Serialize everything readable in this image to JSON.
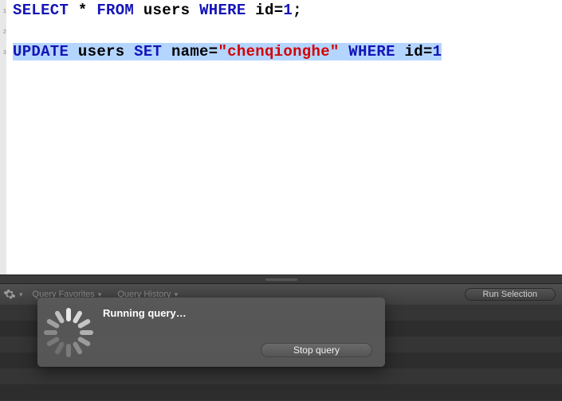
{
  "editor": {
    "line_numbers": [
      "1",
      "2",
      "3"
    ],
    "lines": [
      {
        "selected": false,
        "tokens": [
          {
            "t": "SELECT",
            "c": "kw"
          },
          {
            "t": " ",
            "c": "op"
          },
          {
            "t": "*",
            "c": "op"
          },
          {
            "t": " ",
            "c": "op"
          },
          {
            "t": "FROM",
            "c": "kw"
          },
          {
            "t": " ",
            "c": "op"
          },
          {
            "t": "users",
            "c": "id"
          },
          {
            "t": " ",
            "c": "op"
          },
          {
            "t": "WHERE",
            "c": "kw"
          },
          {
            "t": " ",
            "c": "op"
          },
          {
            "t": "id",
            "c": "id"
          },
          {
            "t": "=",
            "c": "op"
          },
          {
            "t": "1",
            "c": "num"
          },
          {
            "t": ";",
            "c": "op"
          }
        ]
      },
      {
        "selected": false,
        "tokens": []
      },
      {
        "selected": true,
        "tokens": [
          {
            "t": "UPDATE",
            "c": "kw"
          },
          {
            "t": " ",
            "c": "op"
          },
          {
            "t": "users",
            "c": "id"
          },
          {
            "t": " ",
            "c": "op"
          },
          {
            "t": "SET",
            "c": "kw"
          },
          {
            "t": " ",
            "c": "op"
          },
          {
            "t": "name",
            "c": "id"
          },
          {
            "t": "=",
            "c": "op"
          },
          {
            "t": "\"chenqionghe\"",
            "c": "str"
          },
          {
            "t": " ",
            "c": "op"
          },
          {
            "t": "WHERE",
            "c": "kw"
          },
          {
            "t": " ",
            "c": "op"
          },
          {
            "t": "id",
            "c": "id"
          },
          {
            "t": "=",
            "c": "op"
          },
          {
            "t": "1",
            "c": "num"
          }
        ]
      }
    ]
  },
  "toolbar": {
    "favorites_label": "Query Favorites",
    "history_label": "Query History",
    "run_label": "Run Selection"
  },
  "overlay": {
    "status": "Running query…",
    "stop_label": "Stop query"
  },
  "spinner": {
    "blades": [
      {
        "angle": 0,
        "shade": "#e8e8e8"
      },
      {
        "angle": 30,
        "shade": "#d8d8d8"
      },
      {
        "angle": 60,
        "shade": "#c4c4c4"
      },
      {
        "angle": 90,
        "shade": "#b0b0b0"
      },
      {
        "angle": 120,
        "shade": "#9c9c9c"
      },
      {
        "angle": 150,
        "shade": "#8a8a8a"
      },
      {
        "angle": 180,
        "shade": "#7a7a7a"
      },
      {
        "angle": 210,
        "shade": "#707070"
      },
      {
        "angle": 240,
        "shade": "#787878"
      },
      {
        "angle": 270,
        "shade": "#888888"
      },
      {
        "angle": 300,
        "shade": "#a0a0a0"
      },
      {
        "angle": 330,
        "shade": "#c0c0c0"
      }
    ]
  }
}
